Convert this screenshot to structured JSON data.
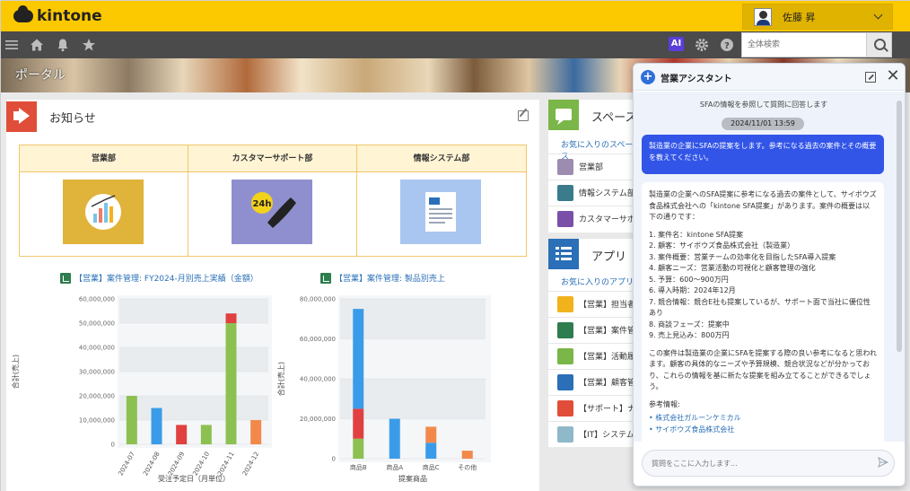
{
  "app": {
    "logo_text": "kintone"
  },
  "user": {
    "name": "佐藤 昇"
  },
  "search": {
    "placeholder": "全体検索"
  },
  "nav": {
    "ai_label": "AI"
  },
  "banner": {
    "title": "ポータル"
  },
  "notice": {
    "title": "お知らせ",
    "departments": [
      {
        "label": "営業部",
        "icon": "chart-report-icon",
        "color": "#e0b33a"
      },
      {
        "label": "カスタマーサポート部",
        "icon": "phone-24h-icon",
        "color": "#8f8fcf"
      },
      {
        "label": "情報システム部",
        "icon": "document-icon",
        "color": "#a9c6f0"
      }
    ]
  },
  "charts": {
    "monthly_link": "【営業】案件管理: FY2024-月別売上実績（金額）",
    "product_link": "【営業】案件管理: 製品別売上"
  },
  "chart_data": [
    {
      "type": "bar",
      "stacked": true,
      "categories": [
        "2024-07",
        "2024-08",
        "2024-09",
        "2024-10",
        "2024-11",
        "2024-12"
      ],
      "series": [
        {
          "color": "#8cc152",
          "values": [
            20000000,
            0,
            0,
            8000000,
            50000000,
            0
          ]
        },
        {
          "color": "#3a9ce8",
          "values": [
            0,
            15000000,
            0,
            0,
            0,
            0
          ]
        },
        {
          "color": "#e04040",
          "values": [
            0,
            0,
            8000000,
            0,
            4000000,
            0
          ]
        },
        {
          "color": "#f2894b",
          "values": [
            0,
            0,
            0,
            0,
            0,
            10000000
          ]
        }
      ],
      "yticks": [
        "0",
        "10,000,000",
        "20,000,000",
        "30,000,000",
        "40,000,000",
        "50,000,000",
        "60,000,000"
      ],
      "ylim": [
        0,
        60000000
      ],
      "xlabel": "受注予定日（月単位）",
      "ylabel": "合計(売上)"
    },
    {
      "type": "bar",
      "stacked": true,
      "categories": [
        "商品B",
        "商品A",
        "商品C",
        "その他"
      ],
      "series": [
        {
          "color": "#8cc152",
          "values": [
            10000000,
            0,
            0,
            0
          ]
        },
        {
          "color": "#e04040",
          "values": [
            15000000,
            0,
            0,
            0
          ]
        },
        {
          "color": "#3a9ce8",
          "values": [
            50000000,
            20000000,
            8000000,
            0
          ]
        },
        {
          "color": "#f2894b",
          "values": [
            0,
            0,
            8000000,
            4000000
          ]
        }
      ],
      "yticks": [
        "0",
        "20,000,000",
        "40,000,000",
        "60,000,000",
        "80,000,000"
      ],
      "ylim": [
        0,
        80000000
      ],
      "xlabel": "提案商品",
      "ylabel": "合計(売上)"
    }
  ],
  "space": {
    "title": "スペース",
    "subtitle": "お気に入りのスペース",
    "items": [
      {
        "label": "営業部",
        "color": "#9c8cb0"
      },
      {
        "label": "情報システム部",
        "color": "#3a7b8c"
      },
      {
        "label": "カスタマーサポート",
        "color": "#7a4fa8"
      }
    ]
  },
  "apps": {
    "title": "アプリ",
    "subtitle": "お気に入りのアプリ",
    "items": [
      {
        "label": "【営業】担当者",
        "color": "#f2b21b"
      },
      {
        "label": "【営業】案件管理",
        "color": "#2e7d4f"
      },
      {
        "label": "【営業】活動履歴",
        "color": "#7ab648"
      },
      {
        "label": "【営業】顧客管理",
        "color": "#2a6fb7"
      },
      {
        "label": "【サポート】ナレッジ",
        "color": "#e04e39"
      },
      {
        "label": "【IT】システム",
        "color": "#8fb8c8"
      }
    ]
  },
  "assistant": {
    "title": "営業アシスタント",
    "intro": "SFAの情報を参照して質問に回答します",
    "date": "2024/11/01 13:59",
    "user_message": "製造業の企業にSFAの提案をします。参考になる過去の案件とその概要を教えてください。",
    "bot_intro": "製造業の企業へのSFA提案に参考になる過去の案件として、サイボウズ食品株式会社への「kintone SFA提案」があります。案件の概要は以下の通りです：",
    "bot_items": [
      "1. 案件名：kintone SFA提案",
      "2. 顧客：サイボウズ食品株式会社（製造業）",
      "3. 案件概要：営業チームの効率化を目指したSFA導入提案",
      "4. 顧客ニーズ：営業活動の可視化と顧客管理の強化",
      "5. 予算：600〜900万円",
      "6. 導入時期：2024年12月",
      "7. 競合情報：競合E社も提案しているが、サポート面で当社に優位性あり",
      "8. 商談フェーズ：提案中",
      "9. 売上見込み：800万円"
    ],
    "bot_summary": "この案件は製造業の企業にSFAを提案する際の良い参考になると思われます。顧客の具体的なニーズや予算規模、競合状況などが分かっており、これらの情報を基に新たな提案を組み立てることができるでしょう。",
    "ref_label": "参考情報:",
    "refs": [
      "株式会社ガルーンケミカル",
      "サイボウズ食品株式会社"
    ],
    "input_placeholder": "質問をここに入力します..."
  },
  "icons": {
    "menu": "menu-icon",
    "home": "home-icon",
    "bell": "bell-icon",
    "star": "star-icon",
    "gear": "gear-icon",
    "help": "help-icon",
    "search": "search-icon"
  }
}
